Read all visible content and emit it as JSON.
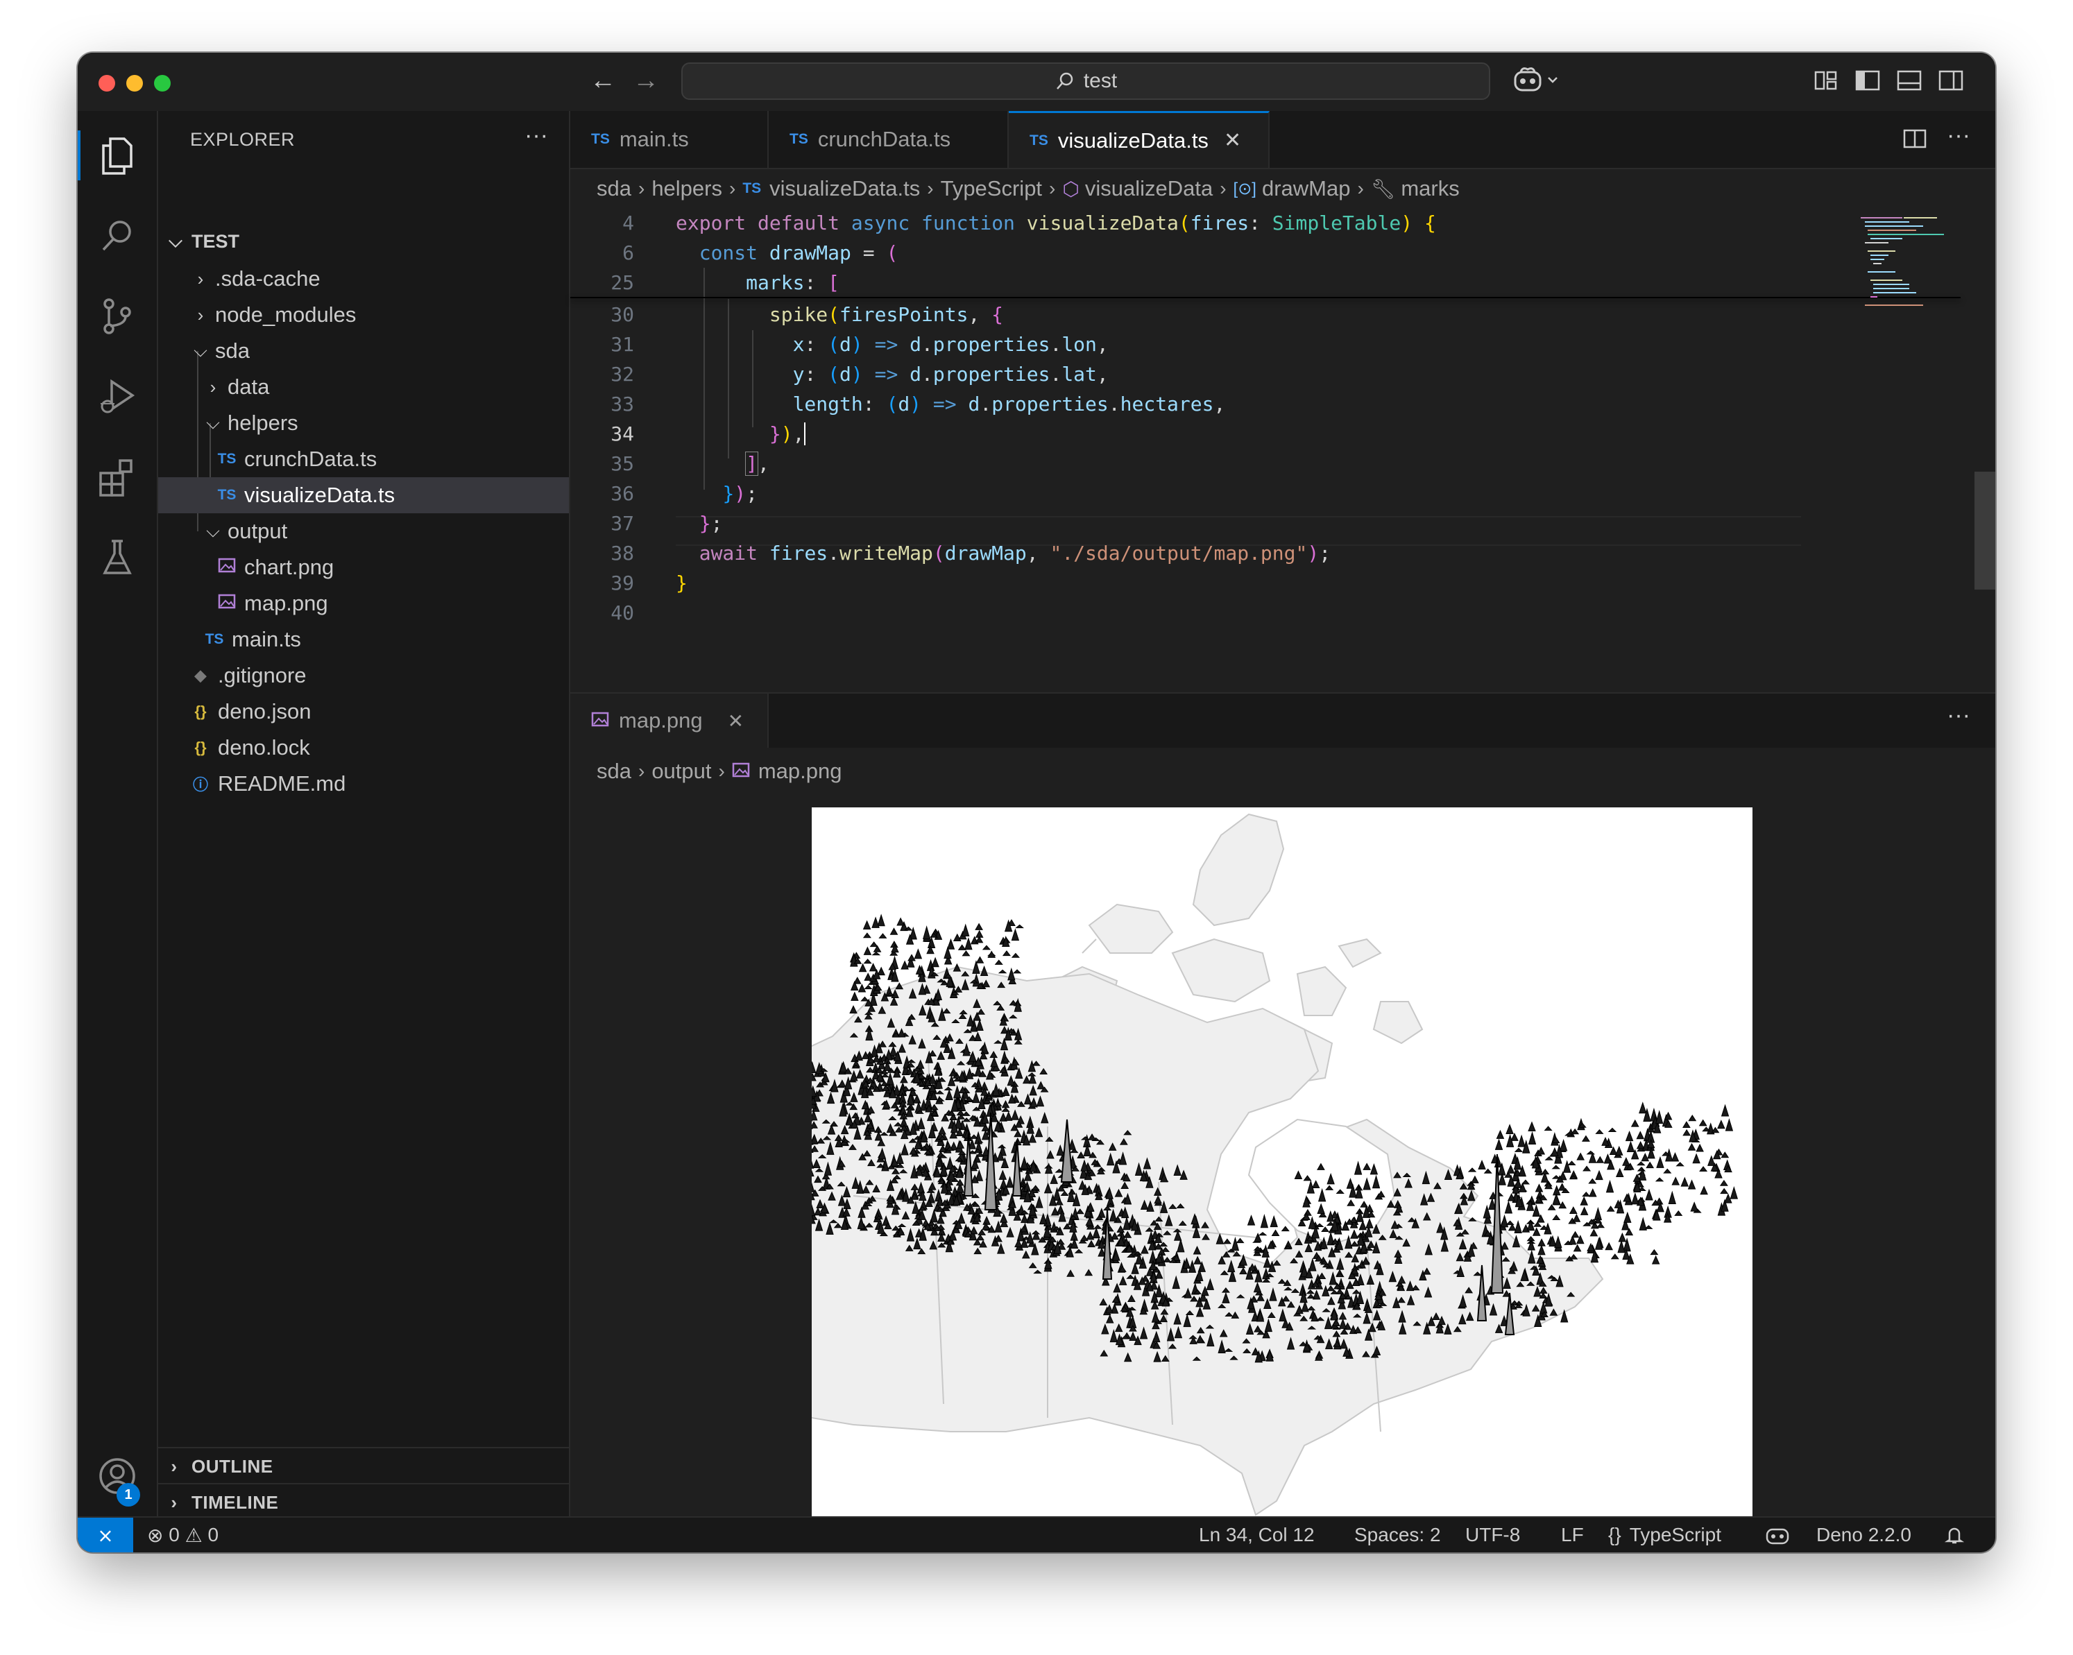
{
  "window": {
    "search_text": "test",
    "traffic_lights": {
      "close": "#ff5f57",
      "minimize": "#febc2e",
      "zoom": "#28c840"
    }
  },
  "activity_bar": {
    "items": [
      "explorer-icon",
      "search-icon",
      "source-control-icon",
      "run-debug-icon",
      "extensions-icon",
      "testing-icon"
    ],
    "accounts_badge": "1"
  },
  "explorer": {
    "title": "EXPLORER",
    "root": "TEST",
    "items": [
      {
        "label": ".sda-cache",
        "kind": "folder",
        "expanded": false
      },
      {
        "label": "node_modules",
        "kind": "folder",
        "expanded": false
      },
      {
        "label": "sda",
        "kind": "folder",
        "expanded": true
      },
      {
        "label": "data",
        "kind": "folder",
        "expanded": false
      },
      {
        "label": "helpers",
        "kind": "folder",
        "expanded": true
      },
      {
        "label": "crunchData.ts",
        "kind": "ts"
      },
      {
        "label": "visualizeData.ts",
        "kind": "ts",
        "selected": true
      },
      {
        "label": "output",
        "kind": "folder",
        "expanded": true
      },
      {
        "label": "chart.png",
        "kind": "image"
      },
      {
        "label": "map.png",
        "kind": "image"
      },
      {
        "label": "main.ts",
        "kind": "ts"
      },
      {
        "label": ".gitignore",
        "kind": "git"
      },
      {
        "label": "deno.json",
        "kind": "json"
      },
      {
        "label": "deno.lock",
        "kind": "json"
      },
      {
        "label": "README.md",
        "kind": "info"
      }
    ],
    "outline": "OUTLINE",
    "timeline": "TIMELINE"
  },
  "tabs": [
    {
      "label": "main.ts",
      "active": false
    },
    {
      "label": "crunchData.ts",
      "active": false
    },
    {
      "label": "visualizeData.ts",
      "active": true
    }
  ],
  "breadcrumb": {
    "items": [
      "sda",
      "helpers",
      "visualizeData.ts",
      "TypeScript",
      "visualizeData",
      "drawMap",
      "marks"
    ]
  },
  "code": {
    "current_line": "34",
    "lines": [
      {
        "n": "4"
      },
      {
        "n": "6"
      },
      {
        "n": "25"
      },
      {
        "n": "30"
      },
      {
        "n": "31"
      },
      {
        "n": "32"
      },
      {
        "n": "33"
      },
      {
        "n": "34"
      },
      {
        "n": "35"
      },
      {
        "n": "36"
      },
      {
        "n": "37"
      },
      {
        "n": "38"
      },
      {
        "n": "39"
      },
      {
        "n": "40"
      }
    ]
  },
  "image_pane": {
    "tab_label": "map.png",
    "breadcrumb": [
      "sda",
      "output",
      "map.png"
    ]
  },
  "status_bar": {
    "errors": "0",
    "warnings": "0",
    "position": "Ln 34, Col 12",
    "spaces": "Spaces: 2",
    "encoding": "UTF-8",
    "eol": "LF",
    "language": "TypeScript",
    "runtime": "Deno 2.2.0"
  },
  "colors": {
    "accent": "#0078d4",
    "editor_bg": "#1f1f1f",
    "sidebar_bg": "#181818"
  }
}
